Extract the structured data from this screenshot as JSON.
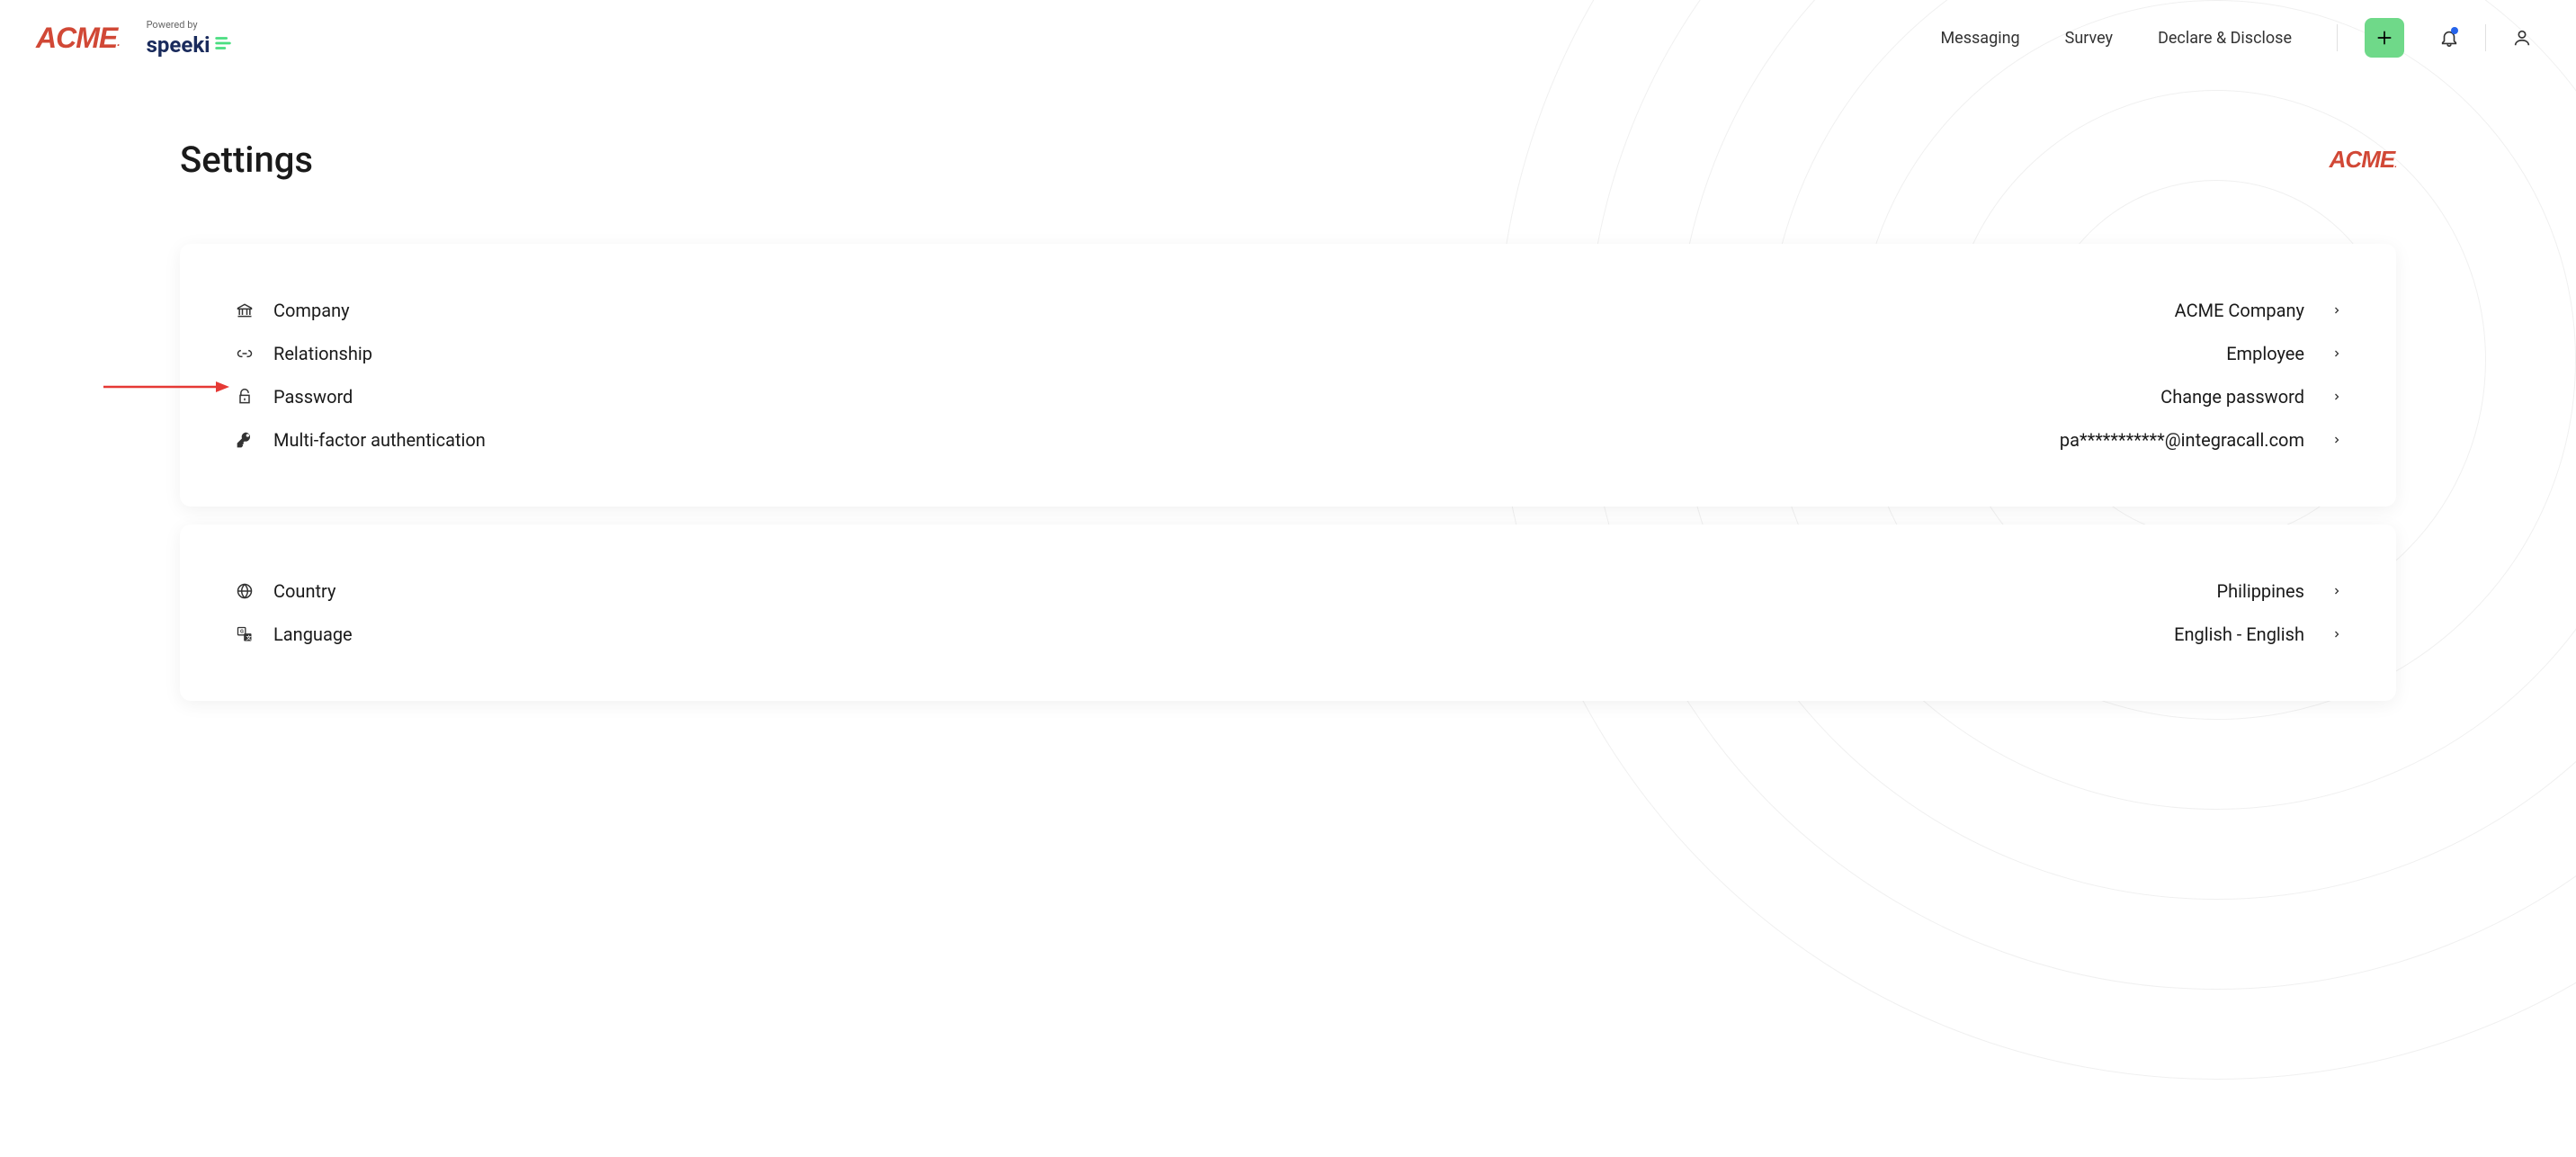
{
  "header": {
    "logo": "ACME",
    "powered_label": "Powered by",
    "speeki": "speeki",
    "nav": [
      "Messaging",
      "Survey",
      "Declare & Disclose"
    ]
  },
  "page": {
    "title": "Settings",
    "company_logo": "ACME"
  },
  "settings_group1": [
    {
      "icon": "bank-icon",
      "label": "Company",
      "value": "ACME Company"
    },
    {
      "icon": "link-icon",
      "label": "Relationship",
      "value": "Employee"
    },
    {
      "icon": "lock-icon",
      "label": "Password",
      "value": "Change password"
    },
    {
      "icon": "key-icon",
      "label": "Multi-factor authentication",
      "value": "pa***********@integracall.com"
    }
  ],
  "settings_group2": [
    {
      "icon": "globe-icon",
      "label": "Country",
      "value": "Philippines"
    },
    {
      "icon": "translate-icon",
      "label": "Language",
      "value": "English - English"
    }
  ]
}
